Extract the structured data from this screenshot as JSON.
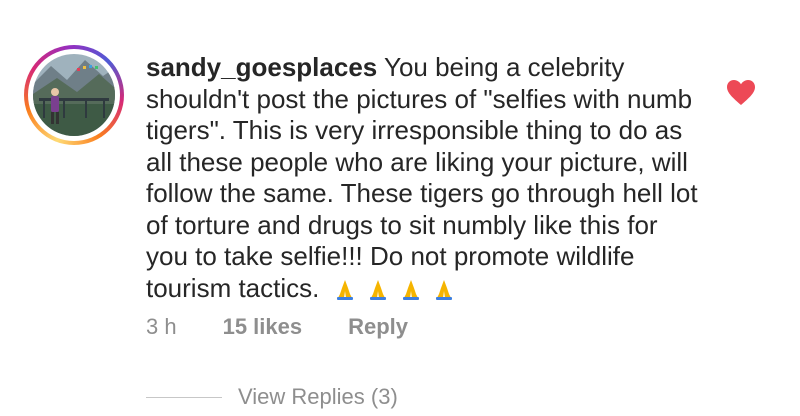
{
  "comment": {
    "username": "sandy_goesplaces",
    "text": "You being a celebrity shouldn't post the pictures of \"selfies with numb tigers\". This is very irresponsible thing to do as all these people who are liking your picture, will follow the same. These tigers go through hell lot of torture and drugs to sit numbly like this for you to take selfie!!! Do not promote wildlife tourism tactics.",
    "emoji": "🙏🙏🙏🙏",
    "emoji_icon": "folded-hands-icon",
    "time": "3 h",
    "likes": "15 likes",
    "reply_label": "Reply",
    "liked": true,
    "heart_color": "#ed4956",
    "heart_icon": "heart-filled-icon"
  },
  "replies": {
    "label": "View Replies (3)"
  },
  "colors": {
    "text": "#262626",
    "secondary": "#8e8e8e"
  }
}
